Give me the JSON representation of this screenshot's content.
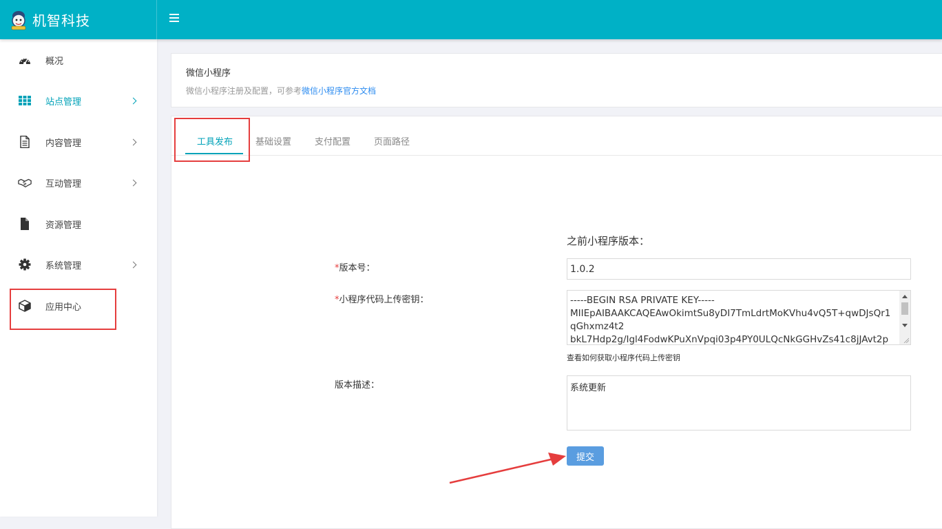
{
  "brand": {
    "name": "机智科技",
    "logo": "mascot-logo"
  },
  "topbar": {
    "menu_icon": "hamburger-icon",
    "accent": "#00b1c6"
  },
  "sidebar": {
    "items": [
      {
        "label": "概况",
        "icon": "dashboard-icon"
      },
      {
        "label": "站点管理",
        "icon": "grid-icon",
        "active": true
      },
      {
        "label": "内容管理",
        "icon": "document-icon"
      },
      {
        "label": "互动管理",
        "icon": "handshake-icon"
      },
      {
        "label": "资源管理",
        "icon": "file-icon"
      },
      {
        "label": "系统管理",
        "icon": "gear-icon"
      },
      {
        "label": "应用中心",
        "icon": "cube-icon"
      }
    ]
  },
  "header": {
    "title": "微信小程序",
    "desc_prefix": "微信小程序注册及配置，可参考",
    "desc_link": "微信小程序官方文档"
  },
  "tabs": [
    "工具发布",
    "基础设置",
    "支付配置",
    "页面路径"
  ],
  "form": {
    "prev_version_label": "之前小程序版本：",
    "version_label": "版本号：",
    "version_value": "1.0.2",
    "key_label": "小程序代码上传密钥：",
    "key_value": "-----BEGIN RSA PRIVATE KEY-----\nMIIEpAIBAAKCAQEAwOkimtSu8yDI7TmLdrtMoKVhu4vQ5T+qwDJsQr1\nqGhxmz4t2\nbkL7Hdp2g/Igl4FodwKPuXnVpqi03p4PY0ULQcNkGGHvZs41c8jJAvt2p",
    "key_help": "查看如何获取小程序代码上传密钥",
    "desc_label": "版本描述：",
    "desc_value": "系统更新",
    "submit": "提交",
    "required_mark": "*"
  },
  "colors": {
    "annotation_red": "#e53d3d",
    "active_teal": "#00a2b8",
    "button_blue": "#5a9de0"
  }
}
